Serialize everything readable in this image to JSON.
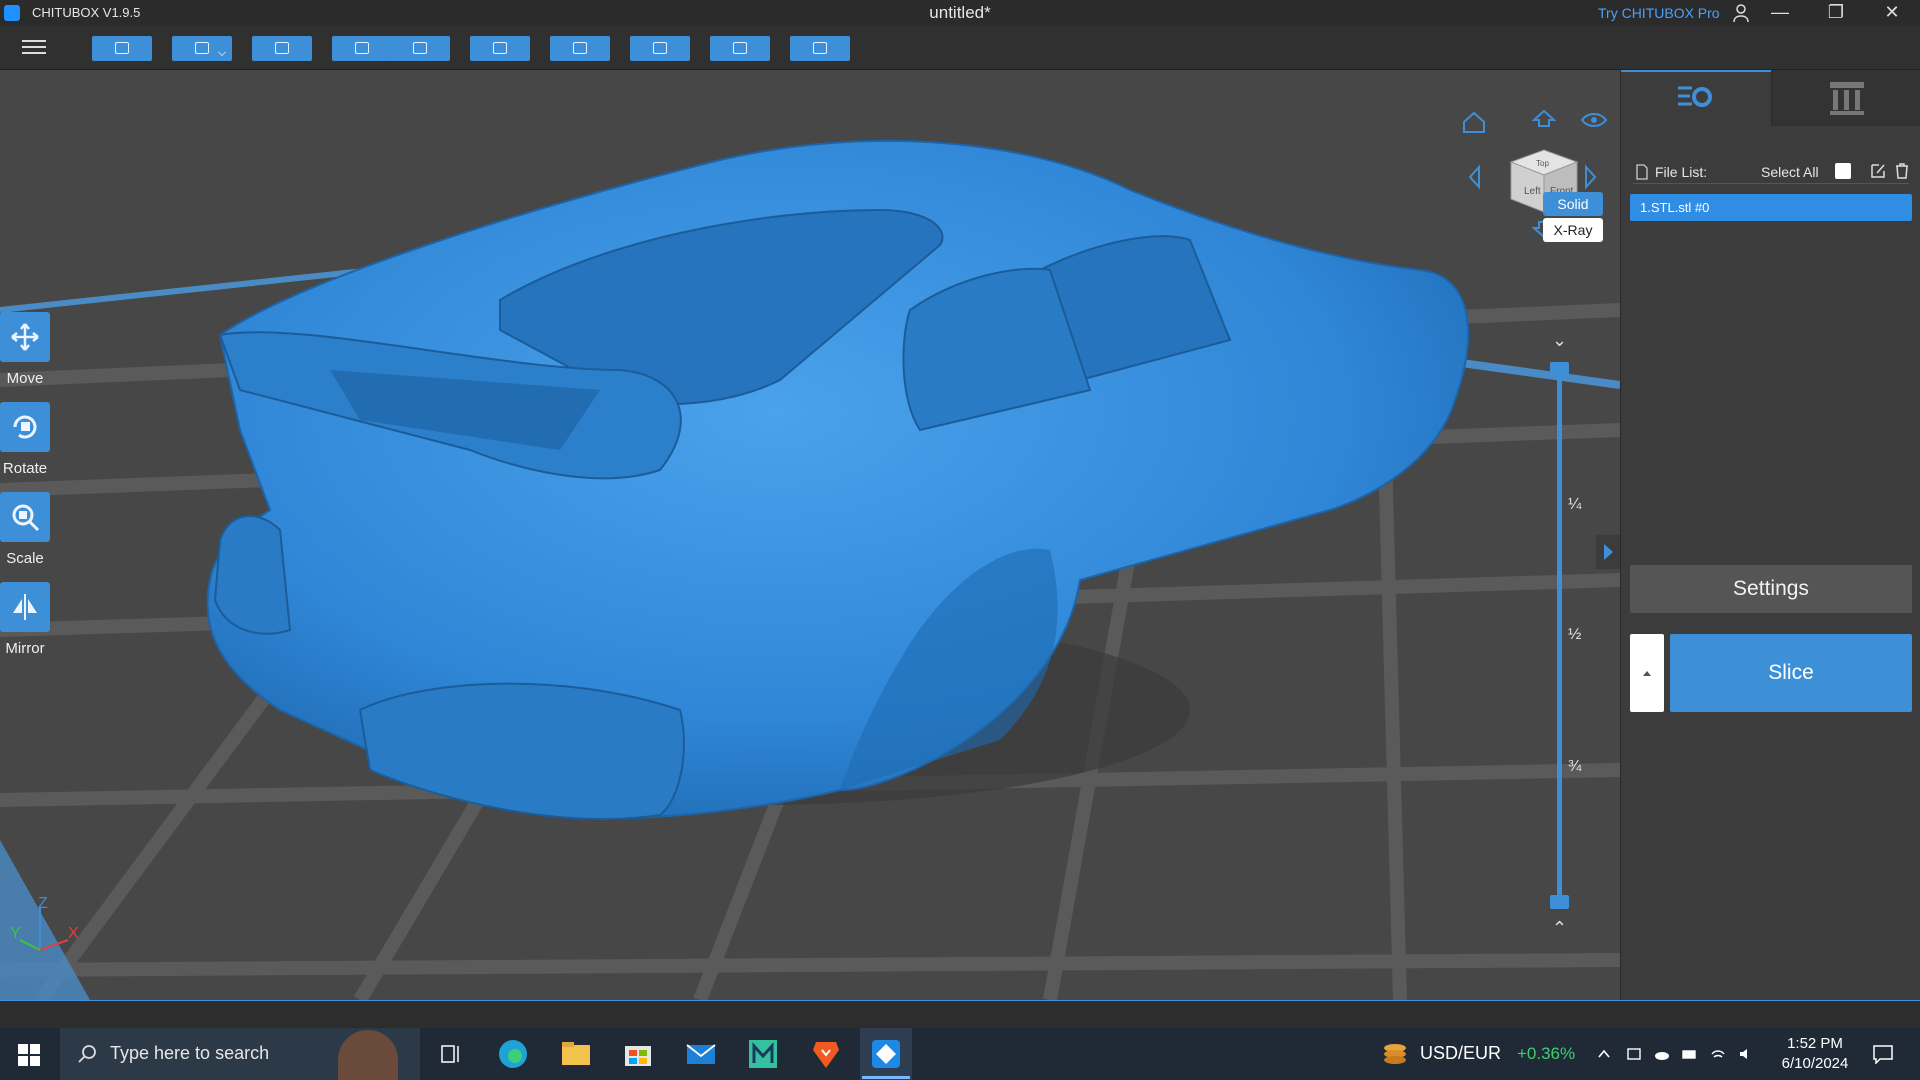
{
  "window": {
    "app_name": "CHITUBOX V1.9.5",
    "doc_title": "untitled*",
    "try_pro": "Try CHITUBOX Pro",
    "minimize": "—",
    "maximize": "❐",
    "close": "✕"
  },
  "toolbar": {
    "buttons": [
      "open-file-icon",
      "save-icon",
      "import-icon",
      "undo-icon",
      "redo-icon",
      "layout-icon",
      "arrange-icon",
      "support-icon",
      "hollow-icon",
      "drain-icon"
    ]
  },
  "tools": {
    "move": "Move",
    "rotate": "Rotate",
    "scale": "Scale",
    "mirror": "Mirror"
  },
  "view": {
    "cube_left": "Left",
    "cube_front": "Front",
    "cube_top": "Top",
    "solid": "Solid",
    "xray": "X-Ray",
    "mark_quarter": "¼",
    "mark_half": "½",
    "mark_three_quarter": "¾",
    "axis_x": "X",
    "axis_y": "Y",
    "axis_z": "Z"
  },
  "panel": {
    "file_list_label": "File List:",
    "select_all": "Select All",
    "files": [
      "1.STL.stl #0"
    ],
    "settings": "Settings",
    "slice": "Slice"
  },
  "taskbar": {
    "search_placeholder": "Type here to search",
    "ticker_symbol": "USD/EUR",
    "ticker_change": "+0.36%",
    "time": "1:52 PM",
    "date": "6/10/2024"
  },
  "colors": {
    "accent": "#3d8fd8",
    "model": "#2f86d6",
    "positive": "#3fcf6f"
  }
}
